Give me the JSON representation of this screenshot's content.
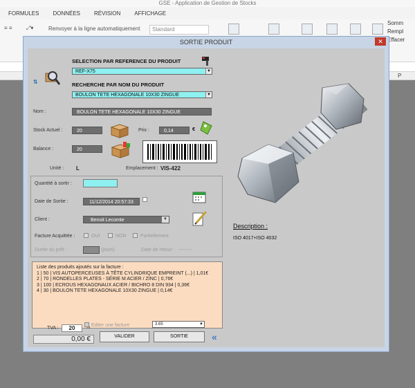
{
  "excel": {
    "title": "GSE - Application de Gestion de Stocks",
    "menu": [
      "FORMULES",
      "DONNÉES",
      "RÉVISION",
      "AFFICHAGE"
    ],
    "wrap_text": "Renvoyer à la ligne automatiquement",
    "format_combo": "Standard",
    "right_items": [
      "Somm",
      "Rempl",
      "Effacer"
    ],
    "col_p": "P"
  },
  "dialog": {
    "title": "SORTIE PRODUIT",
    "close": "✕",
    "ref_label": "SELECTION PAR REFERENCE DU PRODUIT",
    "ref_value": "REF-X75",
    "name_label": "RECHERCHE PAR NOM DU PRODUIT",
    "name_value": "BOULON TETE HEXAGONALE 10X30 ZINGUE",
    "nom_label": "Nom :",
    "nom_value": "BOULON TETE HEXAGONALE 10X30 ZINGUE",
    "stock_label": "Stock Actuel :",
    "stock_value": "20",
    "prix_label": "Prix :",
    "prix_value": "0,14",
    "euro": "€",
    "balance_label": "Balance :",
    "balance_value": "20",
    "unite_label": "Unité :",
    "unite_value": "L",
    "emplacement_label": "Emplacement :",
    "emplacement_value": "VIS-422",
    "quantite_label": "Quantité à sortir :",
    "date_label": "Date de Sortie :",
    "date_value": "11/12/2014 20:57:33",
    "client_label": "Client :",
    "client_value": "Benoit Lecomte",
    "facture_label": "Facture Acquittée :",
    "opt_oui": "OUI",
    "opt_non": "NON",
    "opt_partiel": "Partiellement",
    "duree_label": "Durée du prêt :",
    "jours": "(jours)",
    "retour_label": "Date de retour :",
    "retour_value": "--------",
    "list_header": "Liste des produits ajoutés sur la facture :",
    "list_items": [
      "1 | 50 | VIS AUTOPERCEUSES À TÊTE CYLINDRIQUE EMPREINT (...) | 1,01€",
      "2 | 70 | RONDELLES PLATES - SÉRIE M ACIER / ZINC | 0,76€",
      "3 | 100 | ECROUS HEXAGONAUX ACIER / BICHRO 8 DIN 934 | 0,36€",
      "4 | 30 | BOULON TETE HEXAGONALE 10X30 ZINGUE | 0,14€"
    ],
    "tva_label": "TVA :",
    "tva_value": "20",
    "percent": "%",
    "editer_label": "Editer une facture",
    "invoice_number": "3.65",
    "total": "0,00 €",
    "valider": "VALIDER",
    "sortie": "SORTIE",
    "chevron": "«",
    "description_title": "Description :",
    "description_text": "ISO 4017+ISO 4032"
  }
}
